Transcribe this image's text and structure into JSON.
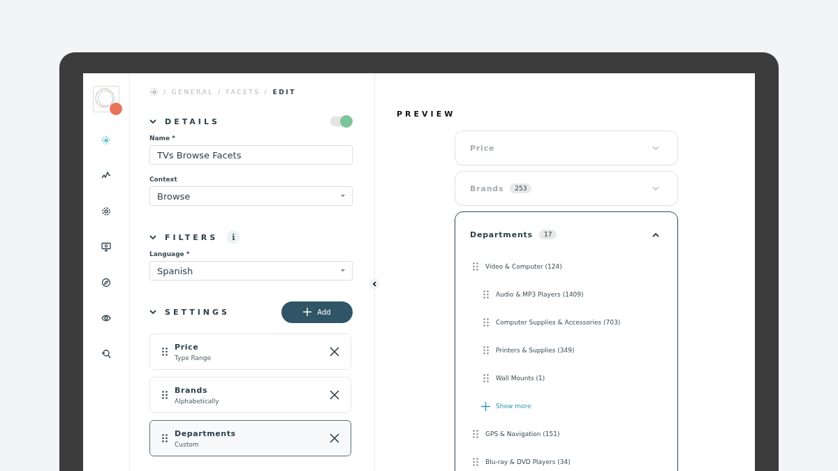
{
  "sidebar": {
    "items": [
      {
        "kind": "sparkle",
        "selected": true
      },
      {
        "kind": "chart",
        "selected": false
      },
      {
        "kind": "gear",
        "selected": false
      },
      {
        "kind": "monitor",
        "selected": false
      },
      {
        "kind": "compass",
        "selected": false
      },
      {
        "kind": "eye",
        "selected": false
      },
      {
        "kind": "search",
        "selected": false
      }
    ]
  },
  "breadcrumb": [
    {
      "separator": "/",
      "label": "GENERAL"
    },
    {
      "separator": "/",
      "label": "FACETS"
    },
    {
      "separator": "/",
      "label": "EDIT"
    }
  ],
  "details": {
    "title": "DETAILS",
    "expanded": true,
    "enabled": true,
    "fields": [
      {
        "label": "Name *",
        "kind": "text",
        "value": "TVs Browse Facets"
      },
      {
        "label": "Context",
        "kind": "select",
        "value": "Browse"
      }
    ]
  },
  "filters": {
    "title": "FILTERS",
    "expanded": true,
    "info": "i",
    "fields": [
      {
        "label": "Language *",
        "kind": "select",
        "value": "Spanish"
      }
    ]
  },
  "settings": {
    "title": "SETTINGS",
    "expanded": true,
    "add_button": "Add",
    "items": [
      {
        "title": "Price",
        "subtitle": "Type Range",
        "selected": false
      },
      {
        "title": "Brands",
        "subtitle": "Alphabetically",
        "selected": false
      },
      {
        "title": "Departments",
        "subtitle": "Custom",
        "selected": true
      }
    ]
  },
  "preview": {
    "title": "PREVIEW",
    "facets": [
      {
        "title": "Price",
        "expanded": false
      },
      {
        "title": "Brands",
        "count": "253",
        "expanded": false
      },
      {
        "title": "Departments",
        "count": "17",
        "expanded": true,
        "items": [
          {
            "label": "Video & Computer (124)",
            "show_more": "Show more",
            "children": [
              {
                "label": "Audio & MP3 Players (1409)"
              },
              {
                "label": "Computer Supplies & Accessories (703)"
              },
              {
                "label": "Printers & Supplies (349)"
              },
              {
                "label": "Wall Mounts (1)"
              }
            ]
          },
          {
            "label": "GPS & Navigation (151)"
          },
          {
            "label": "Blu-ray & DVD Players (34)"
          }
        ]
      }
    ]
  }
}
